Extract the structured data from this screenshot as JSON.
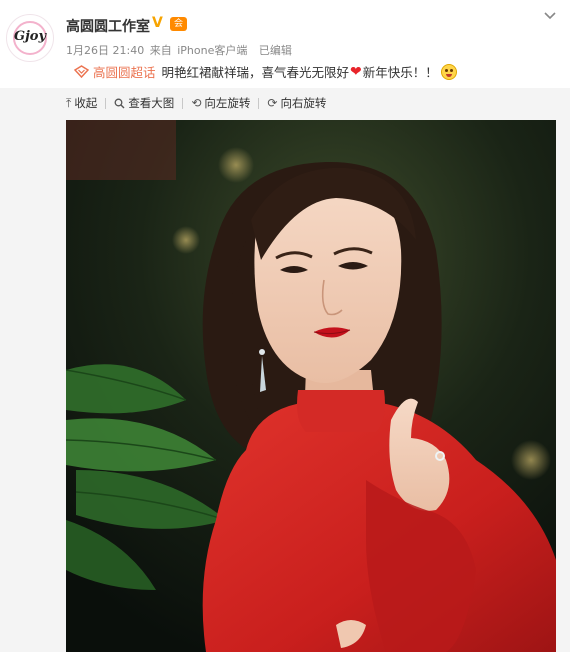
{
  "post": {
    "avatar_text": "Gjoy",
    "username": "高圆圆工作室",
    "verified_mark": "V",
    "member_badge": "会",
    "meta": {
      "date": "1月26日 21:40",
      "source_prefix": "来自",
      "device": "iPhone客户端",
      "edited": "已编辑"
    },
    "topic": "高圆圆超话",
    "text_before_heart": "明艳红裙献祥瑞，喜气春光无限好",
    "heart": "❤",
    "text_after_heart": "新年快乐！！",
    "emoji": "scream-face-emoji"
  },
  "toolbar": {
    "collapse": "收起",
    "view_large": "查看大图",
    "rotate_left": "向左旋转",
    "rotate_right": "向右旋转"
  },
  "colors": {
    "topic": "#eb7350",
    "verified": "#f7a400",
    "heart": "#e8242a",
    "toolbar_bg": "#f4f4f4"
  }
}
